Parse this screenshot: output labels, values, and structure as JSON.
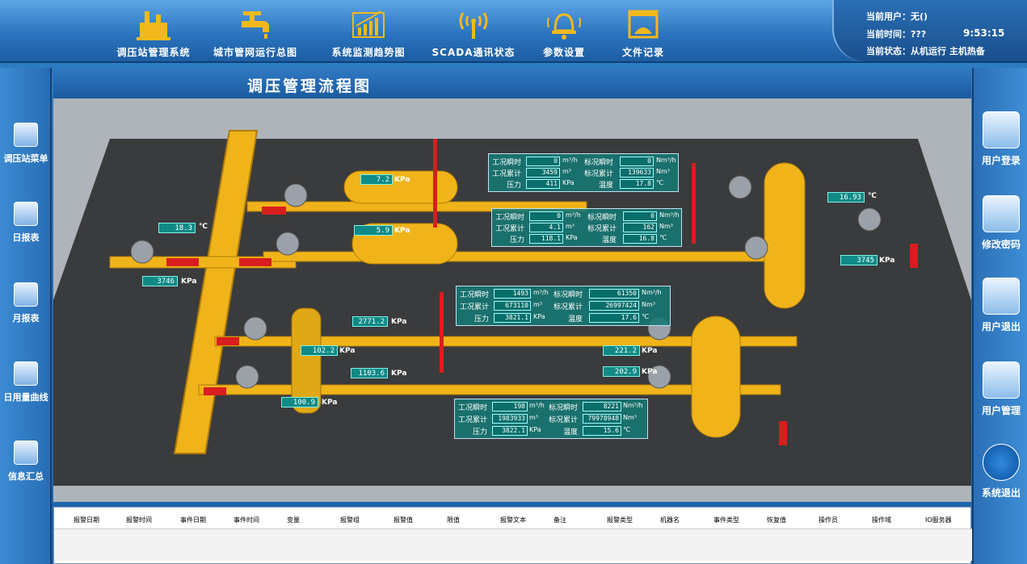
{
  "nav": [
    {
      "label": "调压站管理系统",
      "icon": "factory-icon"
    },
    {
      "label": "城市管网运行总图",
      "icon": "faucet-icon"
    },
    {
      "label": "系统监测趋势图",
      "icon": "trend-chart-icon"
    },
    {
      "label": "SCADA通讯状态",
      "icon": "antenna-icon"
    },
    {
      "label": "参数设置",
      "icon": "bell-icon"
    },
    {
      "label": "文件记录",
      "icon": "document-icon"
    }
  ],
  "status": {
    "user": "当前用户：无()",
    "time_label": "当前时间：???",
    "time_value": "9:53:15",
    "state": "当前状态：从机运行 主机热备"
  },
  "left_menu": [
    {
      "label": "调压站菜单",
      "icon": "station-menu-icon"
    },
    {
      "label": "日报表",
      "icon": "daily-report-icon"
    },
    {
      "label": "月报表",
      "icon": "monthly-report-icon"
    },
    {
      "label": "日用量曲线",
      "icon": "usage-curve-icon"
    },
    {
      "label": "信息汇总",
      "icon": "info-summary-icon"
    }
  ],
  "right_menu": [
    {
      "label": "用户登录",
      "icon": "user-login-icon"
    },
    {
      "label": "修改密码",
      "icon": "lock-icon"
    },
    {
      "label": "用户退出",
      "icon": "user-logout-icon"
    },
    {
      "label": "用户管理",
      "icon": "users-icon"
    },
    {
      "label": "系统退出",
      "icon": "power-icon"
    }
  ],
  "main": {
    "title": "调压管理流程图"
  },
  "readings": [
    {
      "value": "18.3",
      "unit": "℃"
    },
    {
      "value": "3746",
      "unit": "KPa"
    },
    {
      "value": "7.2",
      "unit": "KPa"
    },
    {
      "value": "5.9",
      "unit": "KPa"
    },
    {
      "value": "16.93",
      "unit": "℃"
    },
    {
      "value": "3745",
      "unit": "KPa"
    },
    {
      "value": "2771.2",
      "unit": "KPa"
    },
    {
      "value": "102.2",
      "unit": "KPa"
    },
    {
      "value": "221.2",
      "unit": "KPa"
    },
    {
      "value": "1103.6",
      "unit": "KPa"
    },
    {
      "value": "202.9",
      "unit": "KPa"
    },
    {
      "value": "100.9",
      "unit": "KPa"
    }
  ],
  "infoboxes": [
    {
      "rows": [
        {
          "k1": "工况瞬时",
          "v1": "0",
          "u1": "m³/h",
          "k2": "标况瞬时",
          "v2": "0",
          "u2": "Nm³/h"
        },
        {
          "k1": "工况累计",
          "v1": "3459",
          "u1": "m³",
          "k2": "标况累计",
          "v2": "139633",
          "u2": "Nm³"
        },
        {
          "k1": "压力",
          "v1": "411",
          "u1": "KPa",
          "k2": "温度",
          "v2": "17.8",
          "u2": "℃"
        }
      ]
    },
    {
      "rows": [
        {
          "k1": "工况瞬时",
          "v1": "0",
          "u1": "m³/h",
          "k2": "标况瞬时",
          "v2": "0",
          "u2": "Nm³/h"
        },
        {
          "k1": "工况累计",
          "v1": "4.1",
          "u1": "m³",
          "k2": "标况累计",
          "v2": "162",
          "u2": "Nm³"
        },
        {
          "k1": "压力",
          "v1": "118.1",
          "u1": "KPa",
          "k2": "温度",
          "v2": "16.8",
          "u2": "℃"
        }
      ]
    },
    {
      "rows": [
        {
          "k1": "工况瞬时",
          "v1": "1493",
          "u1": "m³/h",
          "k2": "标况瞬时",
          "v2": "61350",
          "u2": "Nm³/h"
        },
        {
          "k1": "工况累计",
          "v1": "673110",
          "u1": "m³",
          "k2": "标况累计",
          "v2": "26997424",
          "u2": "Nm³"
        },
        {
          "k1": "压力",
          "v1": "3821.1",
          "u1": "KPa",
          "k2": "温度",
          "v2": "17.6",
          "u2": "℃"
        }
      ]
    },
    {
      "rows": [
        {
          "k1": "工况瞬时",
          "v1": "198",
          "u1": "m³/h",
          "k2": "标况瞬时",
          "v2": "8221",
          "u2": "Nm³/h"
        },
        {
          "k1": "工况累计",
          "v1": "1983933",
          "u1": "m³",
          "k2": "标况累计",
          "v2": "79978948",
          "u2": "Nm³"
        },
        {
          "k1": "压力",
          "v1": "3822.1",
          "u1": "KPa",
          "k2": "温度",
          "v2": "15.6",
          "u2": "℃"
        }
      ]
    }
  ],
  "alarm_columns": [
    "报警日期",
    "报警时间",
    "事件日期",
    "事件时间",
    "变量",
    "报警组",
    "报警值",
    "限值",
    "报警文本",
    "备注",
    "报警类型",
    "机器名",
    "事件类型",
    "恢复值",
    "操作员",
    "操作域",
    "IO服务器"
  ]
}
